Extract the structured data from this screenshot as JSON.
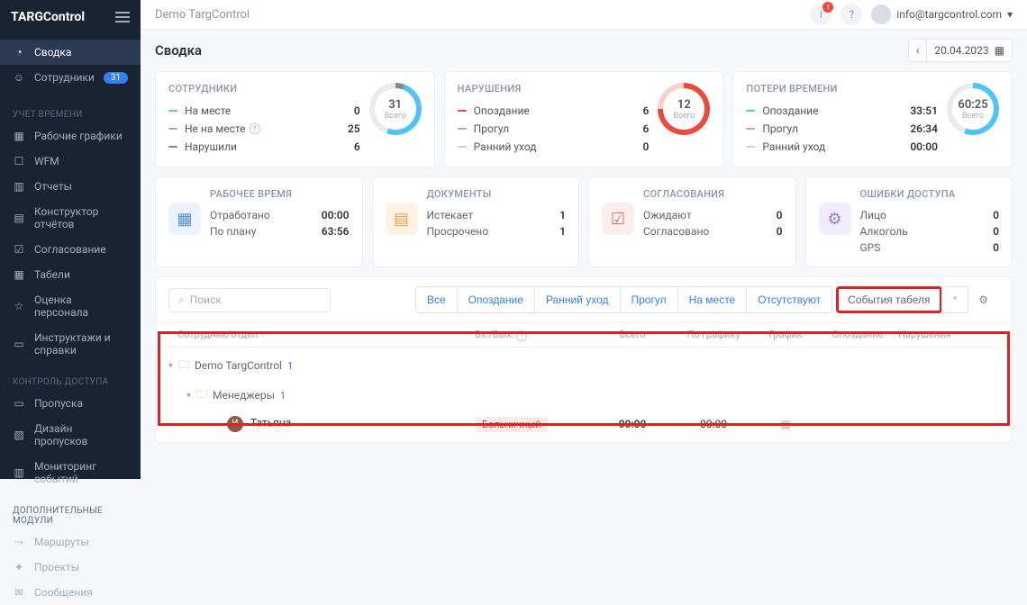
{
  "app": {
    "logo": "TARGControl"
  },
  "topbar": {
    "title": "Demo TargControl",
    "notif_count": "1",
    "user_email": "info@targcontrol.com"
  },
  "nav": {
    "items": [
      "Сводка",
      "Сотрудники"
    ],
    "badge_emp": "31",
    "sec1": "УЧЕТ ВРЕМЕНИ",
    "sec1_items": [
      "Рабочие графики",
      "WFM",
      "Отчеты",
      "Конструктор отчётов",
      "Согласование",
      "Табели",
      "Оценка персонала",
      "Инструктажи и справки"
    ],
    "sec2": "КОНТРОЛЬ ДОСТУПА",
    "sec2_items": [
      "Пропуска",
      "Дизайн пропусков",
      "Мониторинг событий"
    ],
    "sec3": "ДОПОЛНИТЕЛЬНЫЕ МОДУЛИ",
    "sec3_items": [
      "Маршруты",
      "Проекты",
      "Сообщения"
    ]
  },
  "page": {
    "heading": "Сводка",
    "date": "20.04.2023"
  },
  "card_emp": {
    "title": "СОТРУДНИКИ",
    "r1_label": "На месте",
    "r1_val": "0",
    "r2_label": "Не на месте",
    "r2_val": "25",
    "r3_label": "Нарушили",
    "r3_val": "6",
    "donut_num": "31",
    "donut_lbl": "Всего"
  },
  "card_viol": {
    "title": "НАРУШЕНИЯ",
    "r1_label": "Опоздание",
    "r1_val": "6",
    "r2_label": "Прогул",
    "r2_val": "6",
    "r3_label": "Ранний уход",
    "r3_val": "0",
    "donut_num": "12",
    "donut_lbl": "Всего"
  },
  "card_loss": {
    "title": "ПОТЕРИ ВРЕМЕНИ",
    "r1_label": "Опоздание",
    "r1_val": "33:51",
    "r2_label": "Прогул",
    "r2_val": "26:34",
    "r3_label": "Ранний уход",
    "r3_val": "00:00",
    "donut_num": "60:25",
    "donut_lbl": "Всего"
  },
  "card_wt": {
    "title": "РАБОЧЕЕ ВРЕМЯ",
    "k1": "Отработано",
    "v1": "00:00",
    "k2": "По плану",
    "v2": "63:56"
  },
  "card_doc": {
    "title": "ДОКУМЕНТЫ",
    "k1": "Истекает",
    "v1": "1",
    "k2": "Просрочено",
    "v2": "1"
  },
  "card_appr": {
    "title": "СОГЛАСОВАНИЯ",
    "k1": "Ожидают",
    "v1": "0",
    "k2": "Согласовано",
    "v2": "0"
  },
  "card_err": {
    "title": "ОШИБКИ ДОСТУПА",
    "k1": "Лицо",
    "v1": "0",
    "k2": "Алкоголь",
    "v2": "0",
    "k3": "GPS",
    "v3": "0"
  },
  "table": {
    "search": "Поиск",
    "filters": [
      "Все",
      "Опоздание",
      "Ранний уход",
      "Прогул",
      "На месте",
      "Отсутствуют",
      "События табеля"
    ],
    "star": "*",
    "cols": {
      "emp": "Сотрудник/отдел",
      "io": "Вх./Вых.",
      "total": "Всего",
      "plan": "По графику",
      "sched": "График",
      "late": "Опоздание",
      "viol": "Нарушения"
    },
    "g1": "Demo TargControl",
    "g1c": "1",
    "g2": "Менеджеры",
    "g2c": "1",
    "row": {
      "avatar": "И",
      "name": "Татьяна",
      "pill": "Больничный",
      "total": "00:00",
      "plan": "00:00"
    }
  }
}
